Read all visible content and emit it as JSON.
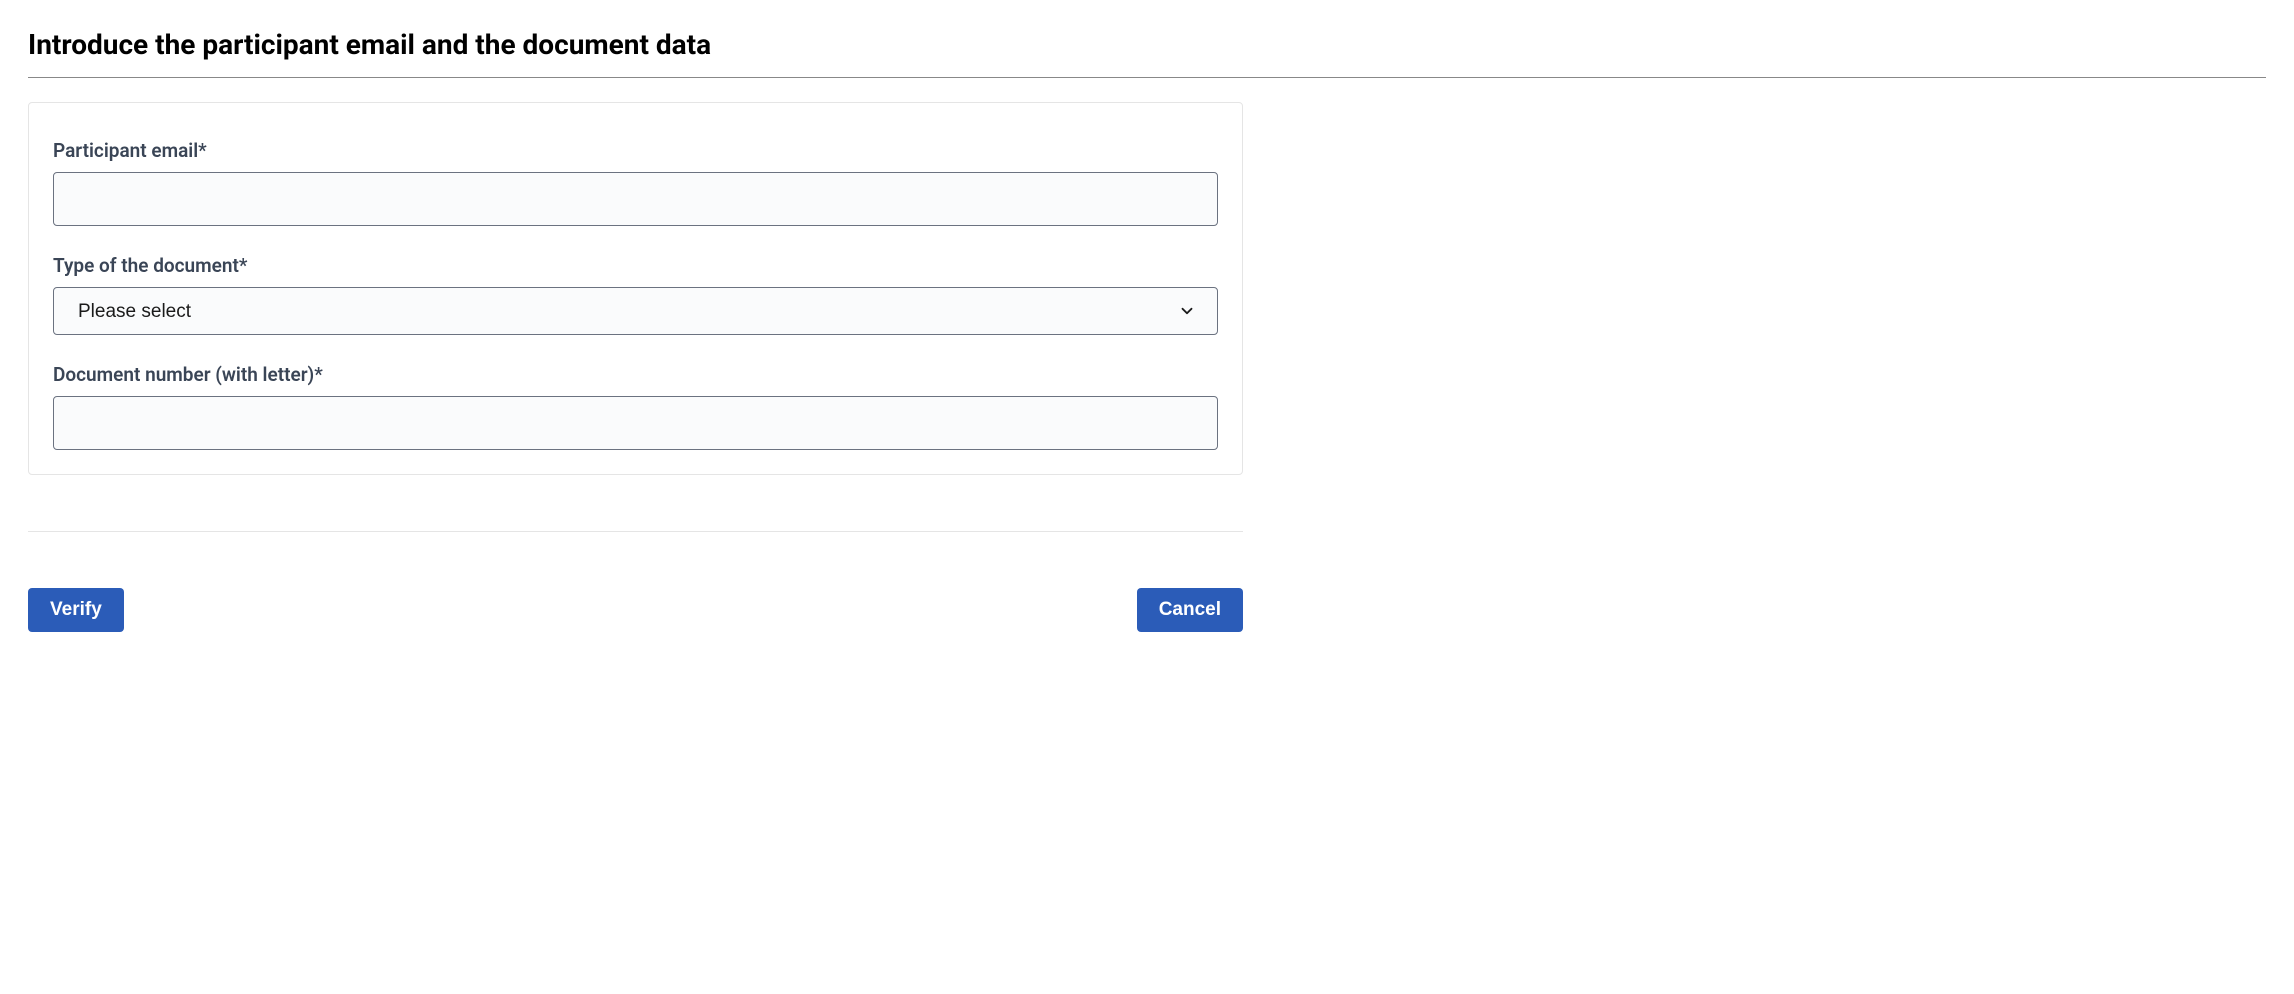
{
  "header": {
    "title": "Introduce the participant email and the document data"
  },
  "form": {
    "email": {
      "label": "Participant email*",
      "value": ""
    },
    "docType": {
      "label": "Type of the document*",
      "selected": "Please select"
    },
    "docNumber": {
      "label": "Document number (with letter)*",
      "value": ""
    }
  },
  "buttons": {
    "verify": "Verify",
    "cancel": "Cancel"
  }
}
